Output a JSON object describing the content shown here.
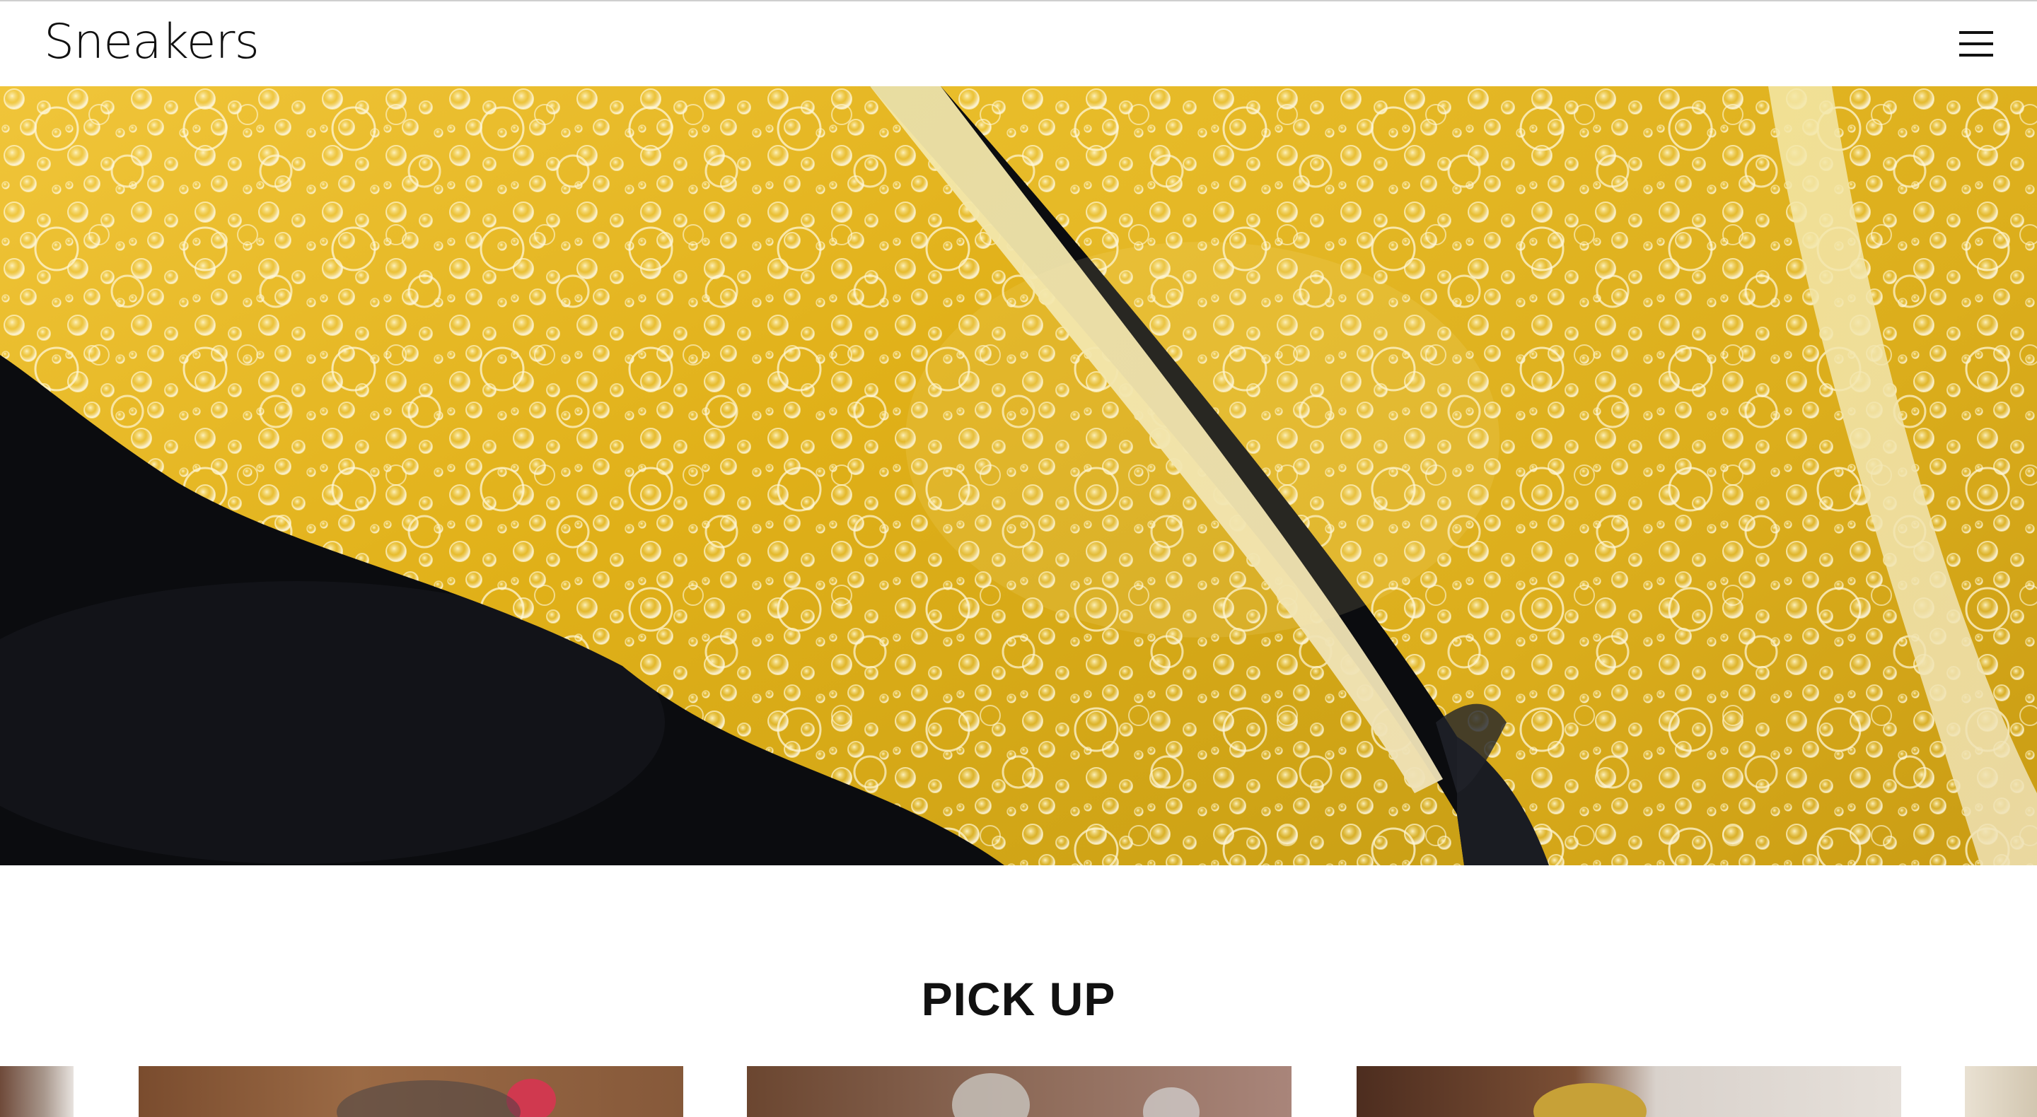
{
  "header": {
    "brand": "Sneakers",
    "menu_icon": "hamburger-menu-icon"
  },
  "hero": {
    "image": "lemon-slices-in-sparkling-water"
  },
  "pickup": {
    "title": "PICK UP",
    "cards": [
      {
        "image": "partial-card-left"
      },
      {
        "image": "dish-with-red-garnish"
      },
      {
        "image": "dish-with-glass-ornament"
      },
      {
        "image": "plated-dish-on-white-plate"
      },
      {
        "image": "partial-card-right"
      }
    ]
  },
  "colors": {
    "background": "#ffffff",
    "text": "#111111",
    "lemon": "#e2b61a",
    "water_dark": "#0b0c0f"
  }
}
